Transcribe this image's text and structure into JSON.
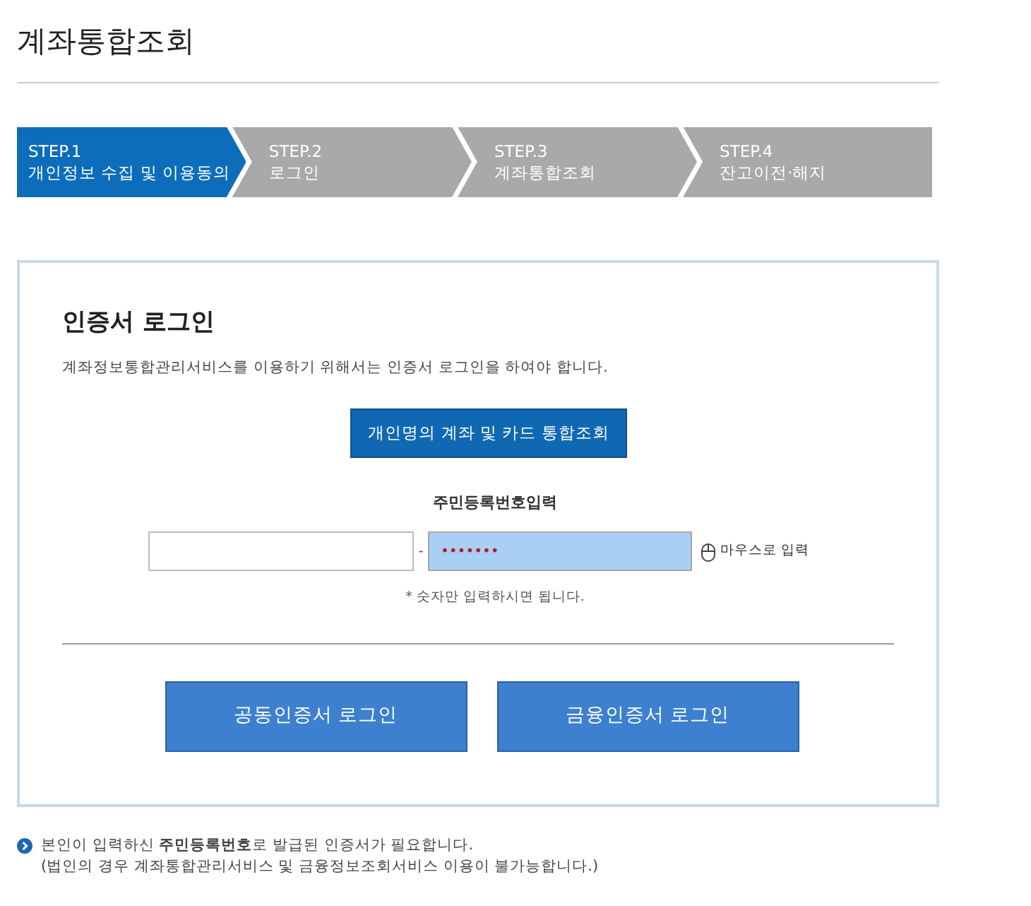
{
  "page_title": "계좌통합조회",
  "steps": [
    {
      "step": "STEP.1",
      "label": "개인정보 수집 및 이용동의",
      "selected": true
    },
    {
      "step": "STEP.2",
      "label": "로그인",
      "selected": false
    },
    {
      "step": "STEP.3",
      "label": "계좌통합조회",
      "selected": false
    },
    {
      "step": "STEP.4",
      "label": "잔고이전·해지",
      "selected": false
    }
  ],
  "login": {
    "title": "인증서 로그인",
    "description": "계좌정보통합관리서비스를 이용하기 위해서는 인증서 로그인을 하여야 합니다.",
    "lookup_button": "개인명의 계좌 및 카드 통합조회",
    "id_label": "주민등록번호입력",
    "separator": "-",
    "id_second": {
      "value": "•••••••"
    },
    "mouse_input": "마우스로 입력",
    "hint": "* 숫자만 입력하시면 됩니다.",
    "buttons": [
      "공동인증서 로그인",
      "금융인증서 로그인"
    ]
  },
  "notes": [
    "본인이 입력하신 **주민등록번호**로 발급된 인증서가 필요합니다.",
    "(법인의 경우 계좌통합관리서비스 및 금융정보조회서비스 이용이 불가능합니다.)"
  ]
}
